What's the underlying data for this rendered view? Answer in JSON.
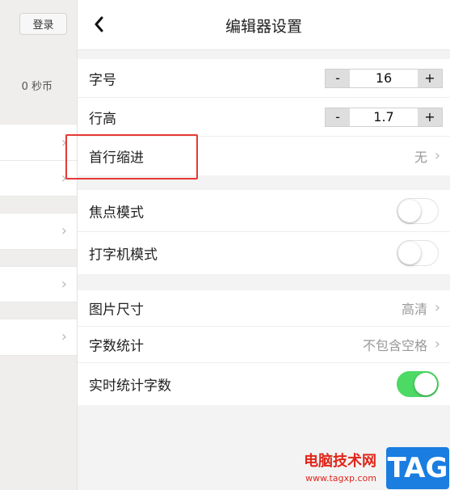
{
  "sidebar": {
    "login_label": "登录",
    "coins_text": "0 秒币"
  },
  "header": {
    "title": "编辑器设置"
  },
  "settings": {
    "font_size": {
      "label": "字号",
      "value": "16",
      "minus": "-",
      "plus": "+"
    },
    "line_height": {
      "label": "行高",
      "value": "1.7",
      "minus": "-",
      "plus": "+"
    },
    "first_line_indent": {
      "label": "首行缩进",
      "value": "无"
    },
    "focus_mode": {
      "label": "焦点模式",
      "enabled": false
    },
    "typewriter_mode": {
      "label": "打字机模式",
      "enabled": false
    },
    "image_size": {
      "label": "图片尺寸",
      "value": "高清"
    },
    "word_count": {
      "label": "字数统计",
      "value": "不包含空格"
    },
    "live_word_count": {
      "label": "实时统计字数",
      "enabled": true
    }
  },
  "watermark": {
    "site_name": "电脑技术网",
    "url": "www.tagxp.com",
    "badge": "TAG"
  },
  "colors": {
    "toggle_on": "#4cd964",
    "highlight_border": "#e53935",
    "watermark_red": "#e0261b",
    "watermark_blue": "#1a7de0"
  },
  "icons": {
    "back": "chevron-left-icon",
    "row_arrow": "chevron-right-icon"
  }
}
